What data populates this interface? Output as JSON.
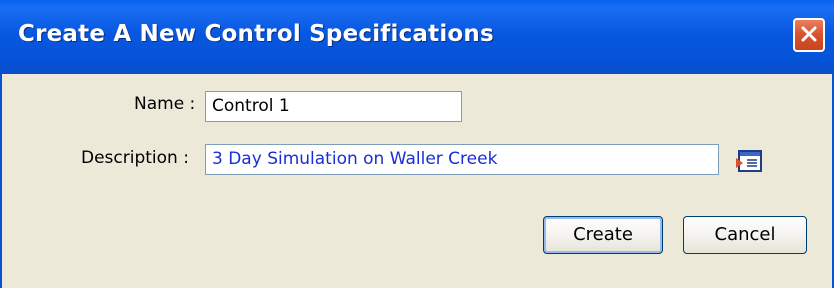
{
  "window": {
    "title": "Create A New Control Specifications"
  },
  "form": {
    "name_label": "Name :",
    "name_value": "Control 1",
    "description_label": "Description :",
    "description_value": "3 Day Simulation on Waller Creek"
  },
  "buttons": {
    "create_label": "Create",
    "cancel_label": "Cancel"
  },
  "icons": {
    "close": "close-icon",
    "browse": "browse-icon"
  },
  "colors": {
    "titlebar": "#0553d8",
    "close_button": "#d8512c",
    "dialog_background": "#ece9d8",
    "description_text": "#1a2dd6"
  }
}
